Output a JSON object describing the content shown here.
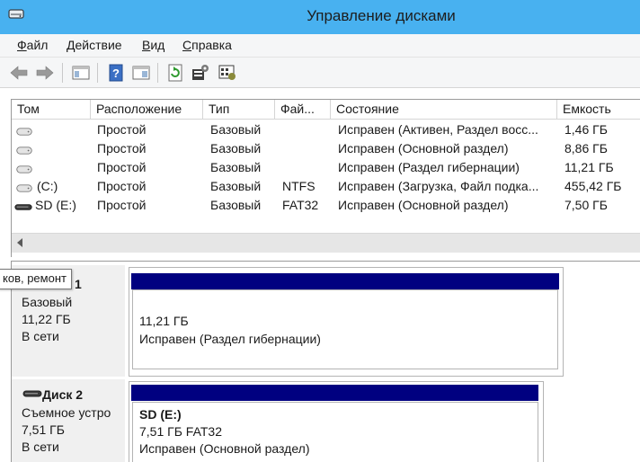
{
  "window": {
    "title": "Управление дисками"
  },
  "menu": [
    {
      "hotkey": "Ф",
      "rest": "айл"
    },
    {
      "hotkey": "Д",
      "rest": "ействие"
    },
    {
      "hotkey": "В",
      "rest": "ид"
    },
    {
      "hotkey": "С",
      "rest": "правка"
    }
  ],
  "toolbar": [
    "back-icon",
    "forward-icon",
    "console-tree-icon",
    "help-icon",
    "properties-icon",
    "refresh-icon",
    "settings-icon",
    "rescan-icon"
  ],
  "volume_list": {
    "columns": [
      "Том",
      "Расположение",
      "Тип",
      "Фай...",
      "Состояние",
      "Емкость"
    ],
    "rows": [
      {
        "volume": "",
        "layout": "Простой",
        "type": "Базовый",
        "fs": "",
        "status": "Исправен (Активен, Раздел восс...",
        "capacity": "1,46 ГБ"
      },
      {
        "volume": "",
        "layout": "Простой",
        "type": "Базовый",
        "fs": "",
        "status": "Исправен (Основной раздел)",
        "capacity": "8,86 ГБ"
      },
      {
        "volume": "",
        "layout": "Простой",
        "type": "Базовый",
        "fs": "",
        "status": "Исправен (Раздел гибернации)",
        "capacity": "11,21 ГБ"
      },
      {
        "volume": "(C:)",
        "layout": "Простой",
        "type": "Базовый",
        "fs": "NTFS",
        "status": "Исправен (Загрузка, Файл подка...",
        "capacity": "455,42 ГБ"
      },
      {
        "volume": "SD (E:)",
        "layout": "Простой",
        "type": "Базовый",
        "fs": "FAT32",
        "status": "Исправен (Основной раздел)",
        "capacity": "7,50 ГБ"
      }
    ]
  },
  "disks": [
    {
      "title_visible": "1",
      "type": "Базовый",
      "size": "11,22 ГБ",
      "status": "В сети",
      "partition": {
        "label": "",
        "size": "11,21 ГБ",
        "status": "Исправен (Раздел гибернации)"
      }
    },
    {
      "title": "Диск 2",
      "type": "Съемное устро",
      "size": "7,51 ГБ",
      "status": "В сети",
      "partition": {
        "label": "SD  (E:)",
        "size": "7,51 ГБ FAT32",
        "status": "Исправен (Основной раздел)"
      }
    }
  ],
  "tooltip": "ков, ремонт",
  "colors": {
    "titlebar": "#48b1f0",
    "partition_header": "#000080"
  }
}
